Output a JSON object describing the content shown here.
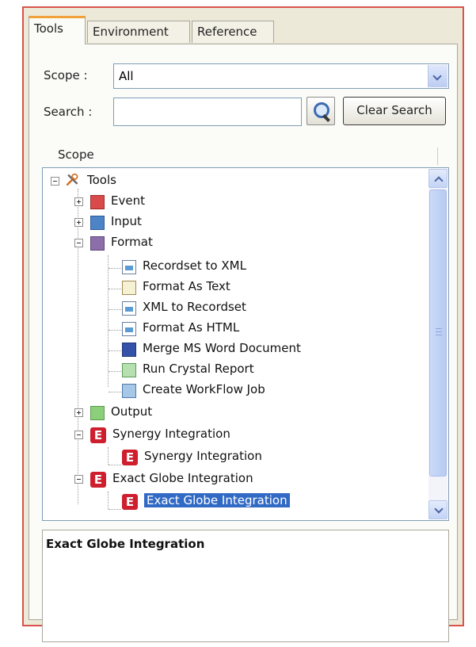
{
  "tabs": [
    {
      "label": "Tools",
      "active": true
    },
    {
      "label": "Environment",
      "active": false
    },
    {
      "label": "Reference",
      "active": false
    }
  ],
  "scope": {
    "label": "Scope :",
    "value": "All"
  },
  "search": {
    "label": "Search :",
    "value": "",
    "clear_label": "Clear Search",
    "icon": "magnifier-icon"
  },
  "column_header": "Scope",
  "tree": {
    "root": "Tools",
    "items": [
      {
        "label": "Event",
        "icon": "event-icon"
      },
      {
        "label": "Input",
        "icon": "input-icon"
      },
      {
        "label": "Format",
        "icon": "format-icon"
      },
      {
        "label": "Recordset to XML",
        "icon": "recordset-to-xml-icon"
      },
      {
        "label": "Format As Text",
        "icon": "format-as-text-icon"
      },
      {
        "label": "XML to Recordset",
        "icon": "xml-to-recordset-icon"
      },
      {
        "label": "Format As HTML",
        "icon": "format-as-html-icon"
      },
      {
        "label": "Merge MS Word Document",
        "icon": "word-document-icon"
      },
      {
        "label": "Run Crystal Report",
        "icon": "crystal-report-icon"
      },
      {
        "label": "Create WorkFlow Job",
        "icon": "workflow-job-icon"
      },
      {
        "label": "Output",
        "icon": "output-icon"
      },
      {
        "label": "Synergy Integration",
        "icon": "e-icon"
      },
      {
        "label": "Synergy Integration",
        "icon": "e-icon"
      },
      {
        "label": "Exact Globe Integration",
        "icon": "e-icon"
      },
      {
        "label": "Exact Globe Integration",
        "icon": "e-icon",
        "selected": true
      }
    ]
  },
  "description": {
    "title": "Exact Globe Integration"
  },
  "colors": {
    "frame_border": "#d9534a",
    "selection": "#316ac5",
    "active_tab_accent": "#f2a13a"
  }
}
